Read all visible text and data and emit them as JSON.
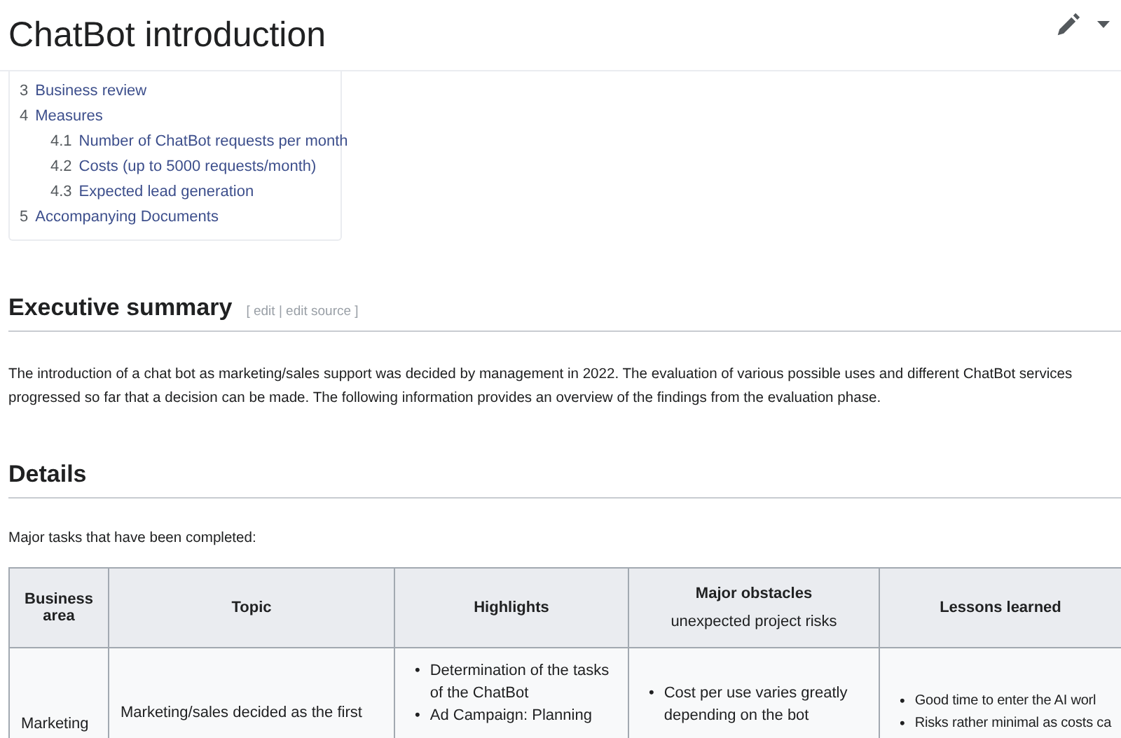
{
  "page_title": "ChatBot introduction",
  "toc": [
    {
      "number": "3",
      "label": "Business review"
    },
    {
      "number": "4",
      "label": "Measures",
      "children": [
        {
          "number": "4.1",
          "label": "Number of ChatBot requests per month"
        },
        {
          "number": "4.2",
          "label": "Costs (up to 5000 requests/month)"
        },
        {
          "number": "4.3",
          "label": "Expected lead generation"
        }
      ]
    },
    {
      "number": "5",
      "label": "Accompanying Documents"
    }
  ],
  "sections": [
    {
      "heading": "Executive summary",
      "edit_links": "[ edit | edit source ]",
      "paragraph": "The introduction of a chat bot as marketing/sales support was decided by management in 2022. The evaluation of various possible uses and different ChatBot services",
      "paragraph_line_2": "progressed so far that a decision can be made. The following information provides an overview of the findings from the evaluation phase."
    },
    {
      "heading": "Details",
      "paragraph": "Major tasks that have been completed:"
    }
  ],
  "table": {
    "columns": [
      {
        "title": "Business area"
      },
      {
        "title": "Topic"
      },
      {
        "title": "Highlights"
      },
      {
        "title": "Major obstacles",
        "subtitle": "unexpected project risks"
      },
      {
        "title": "Lessons learned"
      }
    ],
    "rows": [
      {
        "bullet": "•",
        "business_area": "Marketing",
        "topic": "Marketing/sales decided as the first",
        "highlights": [
          "Determination of the tasks of the ChatBot",
          "Ad Campaign: Planning"
        ],
        "obstacles": [
          "Cost per use varies greatly depending on the bot"
        ],
        "lessons": [
          "Good time to enter the AI worl",
          "Risks rather minimal as costs ca"
        ]
      }
    ]
  }
}
